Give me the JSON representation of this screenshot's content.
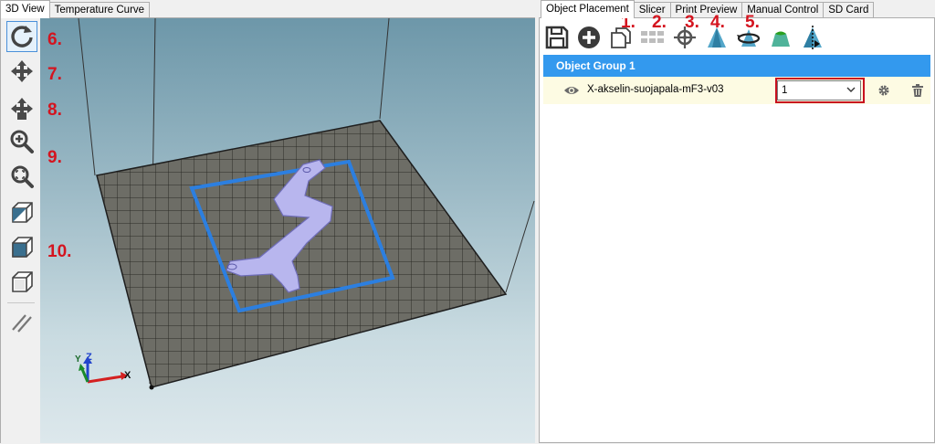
{
  "left_tabs": [
    {
      "label": "3D View",
      "active": true
    },
    {
      "label": "Temperature Curve",
      "active": false
    }
  ],
  "right_tabs": [
    {
      "label": "Object Placement",
      "active": true
    },
    {
      "label": "Slicer",
      "active": false
    },
    {
      "label": "Print Preview",
      "active": false
    },
    {
      "label": "Manual Control",
      "active": false
    },
    {
      "label": "SD Card",
      "active": false
    }
  ],
  "view_tools": [
    {
      "icon": "reset-view-icon",
      "active": true
    },
    {
      "icon": "move-icon",
      "active": false
    },
    {
      "icon": "move-object-icon",
      "active": false
    },
    {
      "icon": "zoom-icon",
      "active": false
    },
    {
      "icon": "fit-view-icon",
      "active": false
    },
    {
      "icon": "cube-front-icon",
      "active": false
    },
    {
      "icon": "cube-top-icon",
      "active": false
    },
    {
      "icon": "cube-side-icon",
      "active": false
    },
    {
      "icon": "parallel-lines-icon",
      "active": false
    }
  ],
  "left_annotations": [
    "6.",
    "7.",
    "8.",
    "9.",
    "10."
  ],
  "top_annotations": [
    "1.",
    "2.",
    "3.",
    "4.",
    "5."
  ],
  "object_toolbar": [
    "save-icon",
    "add-icon",
    "copy-icon",
    "autoposition-icon",
    "center-icon",
    "scale-icon",
    "rotate-icon",
    "cut-icon",
    "mirror-icon"
  ],
  "object_group": {
    "title": "Object Group 1",
    "objects": [
      {
        "name": "X-akselin-suojapala-mF3-v03",
        "extruder": "1"
      }
    ]
  },
  "axes": {
    "x": "X",
    "y": "Y",
    "z": "Z"
  },
  "colors": {
    "accent": "#3399ee",
    "object": "#b8b6ee",
    "highlight": "#c8101e",
    "annotation": "#d4141f"
  }
}
